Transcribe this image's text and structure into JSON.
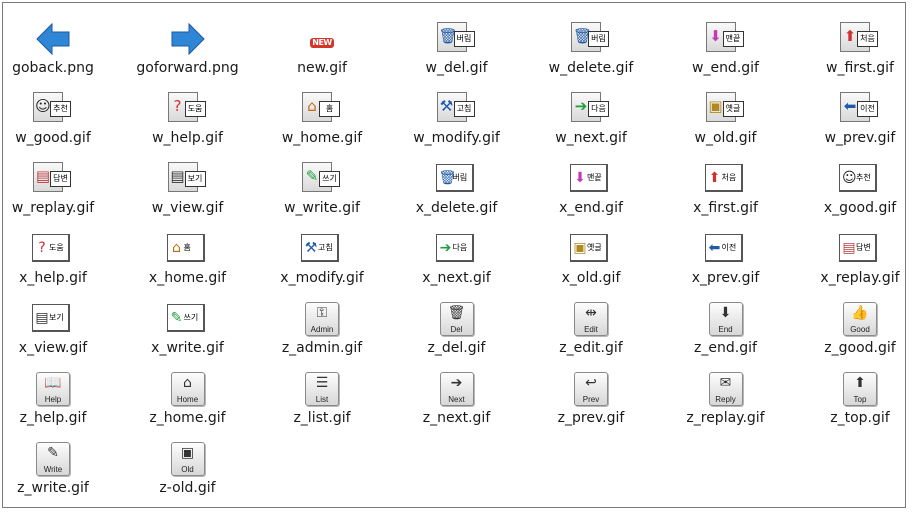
{
  "files": [
    {
      "name": "goback.png",
      "icon": "back-arrow-icon",
      "kind": "arrowL",
      "color": "#2f86d6"
    },
    {
      "name": "goforward.png",
      "icon": "forward-arrow-icon",
      "kind": "arrowR",
      "color": "#2f86d6"
    },
    {
      "name": "new.gif",
      "icon": "new-badge-icon",
      "kind": "new",
      "text": "NEW"
    },
    {
      "name": "w_del.gif",
      "icon": "trash-icon",
      "kind": "w",
      "glyph": "🗑",
      "tag": "버림",
      "color": "#1e5aa8"
    },
    {
      "name": "w_delete.gif",
      "icon": "trash-icon",
      "kind": "w",
      "glyph": "🗑",
      "tag": "버림",
      "color": "#1e5aa8"
    },
    {
      "name": "w_end.gif",
      "icon": "arrow-down-icon",
      "kind": "w",
      "glyph": "⬇",
      "tag": "맨끝",
      "color": "#c23bb3"
    },
    {
      "name": "w_first.gif",
      "icon": "arrow-up-icon",
      "kind": "w",
      "glyph": "⬆",
      "tag": "처음",
      "color": "#d32f2f"
    },
    {
      "name": "w_good.gif",
      "icon": "person-icon",
      "kind": "w",
      "glyph": "☺",
      "tag": "추천",
      "color": "#222222"
    },
    {
      "name": "w_help.gif",
      "icon": "question-icon",
      "kind": "w",
      "glyph": "?",
      "tag": "도움",
      "color": "#d32f2f"
    },
    {
      "name": "w_home.gif",
      "icon": "house-icon",
      "kind": "w",
      "glyph": "⌂",
      "tag": "홈",
      "color": "#c46a10"
    },
    {
      "name": "w_modify.gif",
      "icon": "wrench-icon",
      "kind": "w",
      "glyph": "⚒",
      "tag": "고침",
      "color": "#1e5aa8"
    },
    {
      "name": "w_next.gif",
      "icon": "arrow-right-icon",
      "kind": "w",
      "glyph": "➔",
      "tag": "다음",
      "color": "#1e9e3c"
    },
    {
      "name": "w_old.gif",
      "icon": "folder-icon",
      "kind": "w",
      "glyph": "▣",
      "tag": "옛글",
      "color": "#b08a1e"
    },
    {
      "name": "w_prev.gif",
      "icon": "arrow-left-icon",
      "kind": "w",
      "glyph": "⬅",
      "tag": "이전",
      "color": "#1e5aa8"
    },
    {
      "name": "w_replay.gif",
      "icon": "document-icon",
      "kind": "w",
      "glyph": "▤",
      "tag": "답변",
      "color": "#c23b3b"
    },
    {
      "name": "w_view.gif",
      "icon": "document-icon",
      "kind": "w",
      "glyph": "▤",
      "tag": "보기",
      "color": "#333333"
    },
    {
      "name": "w_write.gif",
      "icon": "pencil-icon",
      "kind": "w",
      "glyph": "✎",
      "tag": "쓰기",
      "color": "#1e9e3c"
    },
    {
      "name": "x_delete.gif",
      "icon": "trash-icon",
      "kind": "x",
      "glyph": "🗑",
      "tag": "버림",
      "color": "#1e5aa8"
    },
    {
      "name": "x_end.gif",
      "icon": "arrow-down-icon",
      "kind": "x",
      "glyph": "⬇",
      "tag": "맨끝",
      "color": "#c23bb3"
    },
    {
      "name": "x_first.gif",
      "icon": "arrow-up-icon",
      "kind": "x",
      "glyph": "⬆",
      "tag": "처음",
      "color": "#d32f2f"
    },
    {
      "name": "x_good.gif",
      "icon": "person-icon",
      "kind": "x",
      "glyph": "☺",
      "tag": "추천",
      "color": "#222222"
    },
    {
      "name": "x_help.gif",
      "icon": "question-icon",
      "kind": "x",
      "glyph": "?",
      "tag": "도움",
      "color": "#d32f2f"
    },
    {
      "name": "x_home.gif",
      "icon": "house-icon",
      "kind": "x",
      "glyph": "⌂",
      "tag": "홈",
      "color": "#c46a10"
    },
    {
      "name": "x_modify.gif",
      "icon": "wrench-icon",
      "kind": "x",
      "glyph": "⚒",
      "tag": "고침",
      "color": "#1e5aa8"
    },
    {
      "name": "x_next.gif",
      "icon": "arrow-right-icon",
      "kind": "x",
      "glyph": "➔",
      "tag": "다음",
      "color": "#1e9e3c"
    },
    {
      "name": "x_old.gif",
      "icon": "folder-icon",
      "kind": "x",
      "glyph": "▣",
      "tag": "옛글",
      "color": "#b08a1e"
    },
    {
      "name": "x_prev.gif",
      "icon": "arrow-left-icon",
      "kind": "x",
      "glyph": "⬅",
      "tag": "이전",
      "color": "#1e5aa8"
    },
    {
      "name": "x_replay.gif",
      "icon": "document-icon",
      "kind": "x",
      "glyph": "▤",
      "tag": "답변",
      "color": "#c23b3b"
    },
    {
      "name": "x_view.gif",
      "icon": "document-icon",
      "kind": "x",
      "glyph": "▤",
      "tag": "보기",
      "color": "#333333"
    },
    {
      "name": "x_write.gif",
      "icon": "pencil-icon",
      "kind": "x",
      "glyph": "✎",
      "tag": "쓰기",
      "color": "#1e9e3c"
    },
    {
      "name": "z_admin.gif",
      "icon": "key-icon",
      "kind": "z",
      "glyph": "⚿",
      "tag": "Admin"
    },
    {
      "name": "z_del.gif",
      "icon": "trash-icon",
      "kind": "z",
      "glyph": "🗑",
      "tag": "Del"
    },
    {
      "name": "z_edit.gif",
      "icon": "edit-icon",
      "kind": "z",
      "glyph": "⇹",
      "tag": "Edit"
    },
    {
      "name": "z_end.gif",
      "icon": "arrow-down-icon",
      "kind": "z",
      "glyph": "⬇",
      "tag": "End"
    },
    {
      "name": "z_good.gif",
      "icon": "thumbs-up-icon",
      "kind": "z",
      "glyph": "👍",
      "tag": "Good"
    },
    {
      "name": "z_help.gif",
      "icon": "book-icon",
      "kind": "z",
      "glyph": "📖",
      "tag": "Help"
    },
    {
      "name": "z_home.gif",
      "icon": "house-icon",
      "kind": "z",
      "glyph": "⌂",
      "tag": "Home"
    },
    {
      "name": "z_list.gif",
      "icon": "list-icon",
      "kind": "z",
      "glyph": "☰",
      "tag": "List"
    },
    {
      "name": "z_next.gif",
      "icon": "arrow-right-icon",
      "kind": "z",
      "glyph": "➔",
      "tag": "Next"
    },
    {
      "name": "z_prev.gif",
      "icon": "arrow-back-icon",
      "kind": "z",
      "glyph": "↩",
      "tag": "Prev"
    },
    {
      "name": "z_replay.gif",
      "icon": "reply-icon",
      "kind": "z",
      "glyph": "✉",
      "tag": "Reply"
    },
    {
      "name": "z_top.gif",
      "icon": "arrow-up-icon",
      "kind": "z",
      "glyph": "⬆",
      "tag": "Top"
    },
    {
      "name": "z_write.gif",
      "icon": "pencil-icon",
      "kind": "z",
      "glyph": "✎",
      "tag": "Write"
    },
    {
      "name": "z-old.gif",
      "icon": "folder-icon",
      "kind": "z",
      "glyph": "▣",
      "tag": "Old"
    }
  ]
}
